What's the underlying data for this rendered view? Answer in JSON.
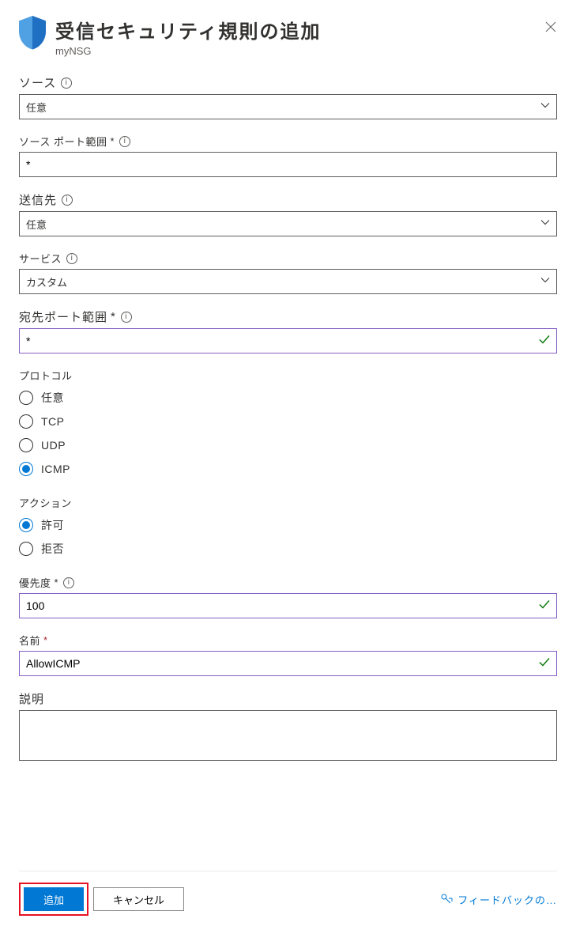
{
  "header": {
    "title": "受信セキュリティ規則の追加",
    "subtitle": "myNSG"
  },
  "source": {
    "label": "ソース",
    "value": "任意"
  },
  "sourcePort": {
    "label": "ソース ポート範囲",
    "value": "*"
  },
  "destination": {
    "label": "送信先",
    "value": "任意"
  },
  "service": {
    "label": "サービス",
    "value": "カスタム"
  },
  "destPort": {
    "label": "宛先ポート範囲",
    "value": "*"
  },
  "protocol": {
    "label": "プロトコル",
    "options": {
      "any": "任意",
      "tcp": "TCP",
      "udp": "UDP",
      "icmp": "ICMP"
    },
    "selected": "icmp"
  },
  "action": {
    "label": "アクション",
    "options": {
      "allow": "許可",
      "deny": "拒否"
    },
    "selected": "allow"
  },
  "priority": {
    "label": "優先度",
    "value": "100"
  },
  "name": {
    "label": "名前",
    "value": "AllowICMP"
  },
  "description": {
    "label": "説明",
    "value": ""
  },
  "footer": {
    "add": "追加",
    "cancel": "キャンセル",
    "feedback": "フィードバックの…"
  }
}
